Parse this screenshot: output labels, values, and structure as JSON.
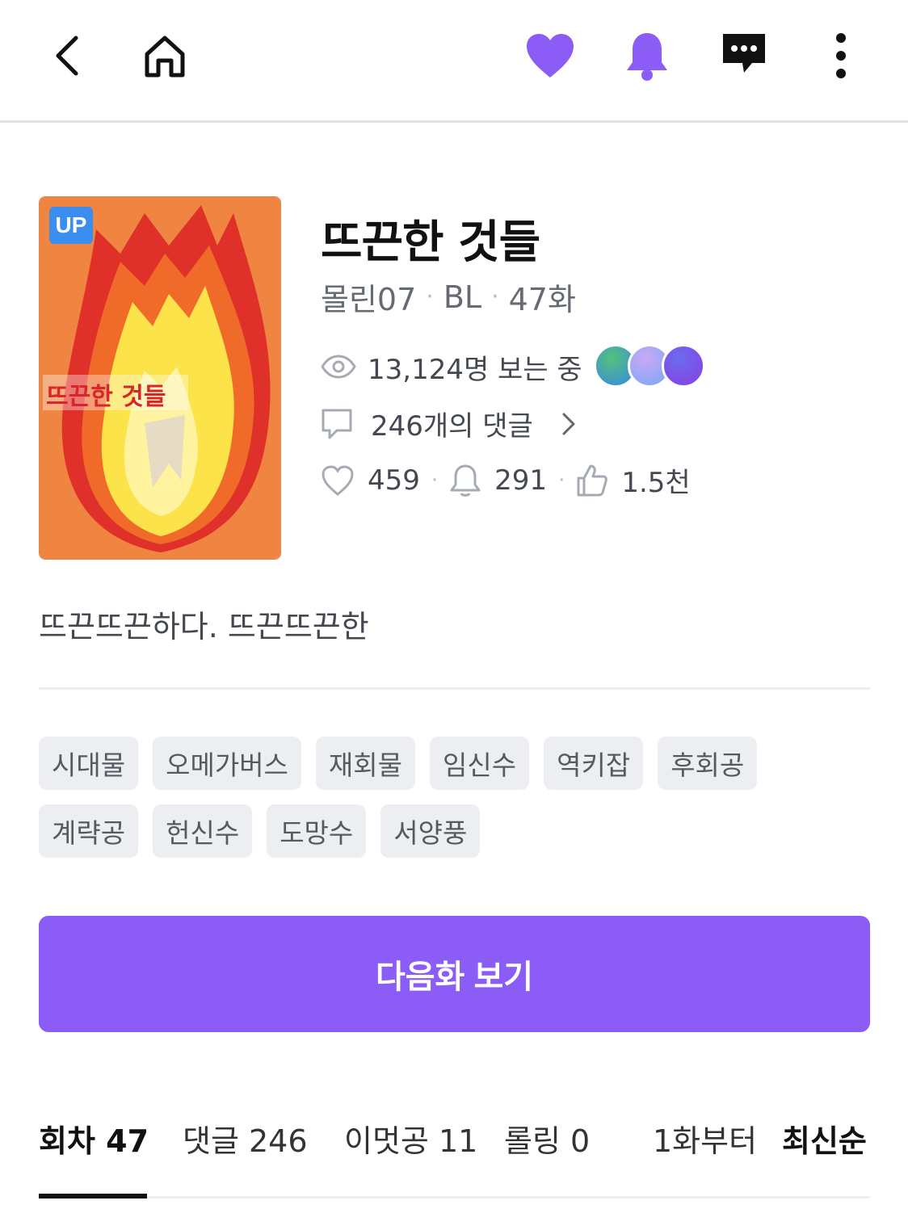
{
  "topbar": {
    "back_icon": "chevron-left-icon",
    "home_icon": "home-icon",
    "heart_icon": "heart-icon",
    "bell_icon": "bell-icon",
    "chat_icon": "chat-icon",
    "more_icon": "more-vertical-icon"
  },
  "cover": {
    "badge": "UP",
    "title_text": "뜨끈한 것들"
  },
  "work": {
    "title": "뜨끈한 것들",
    "author": "몰린07",
    "genre": "BL",
    "episodes": "47화",
    "viewers": "13,124명 보는 중",
    "comments": "246개의 댓글",
    "likes": "459",
    "alarms": "291",
    "recommends": "1.5천"
  },
  "description": "뜨끈뜨끈하다. 뜨끈뜨끈한",
  "tags": [
    "시대물",
    "오메가버스",
    "재회물",
    "임신수",
    "역키잡",
    "후회공",
    "계략공",
    "헌신수",
    "도망수",
    "서양풍"
  ],
  "cta": {
    "label": "다음화 보기"
  },
  "tabs": [
    {
      "label": "회차 47"
    },
    {
      "label": "댓글 246"
    },
    {
      "label": "이멋공 11"
    },
    {
      "label": "롤링 0"
    }
  ],
  "sort": {
    "from_first": "1화부터",
    "latest": "최신순"
  },
  "colors": {
    "accent": "#8b5cf6",
    "icon_purple": "#8b5cf6"
  }
}
